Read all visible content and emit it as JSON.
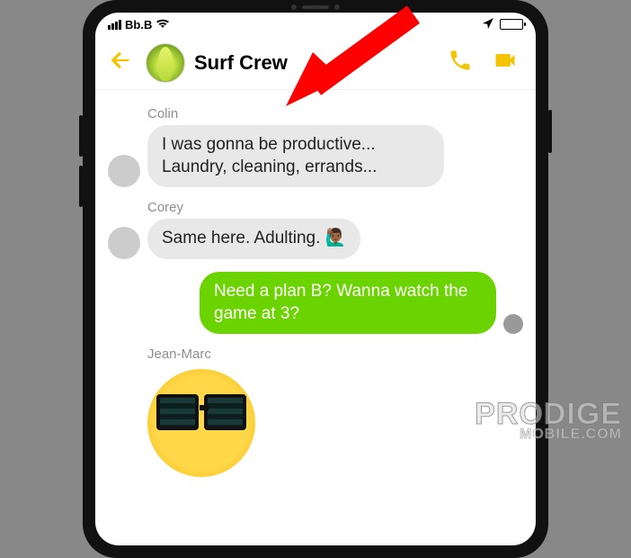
{
  "statusbar": {
    "carrier": "Bb.B"
  },
  "header": {
    "title": "Surf Crew"
  },
  "messages": [
    {
      "sender": "Colin",
      "direction": "in",
      "text": "I was gonna be productive... Laundry, cleaning, errands..."
    },
    {
      "sender": "Corey",
      "direction": "in",
      "text": "Same here. Adulting. 🙋🏾‍♂️"
    },
    {
      "sender": "me",
      "direction": "out",
      "text": "Need a plan B? Wanna watch the game at 3?"
    },
    {
      "sender": "Jean-Marc",
      "direction": "in",
      "text": ""
    }
  ],
  "watermark": {
    "line1": "PRODIGE",
    "line2": "MOBILE.COM"
  }
}
